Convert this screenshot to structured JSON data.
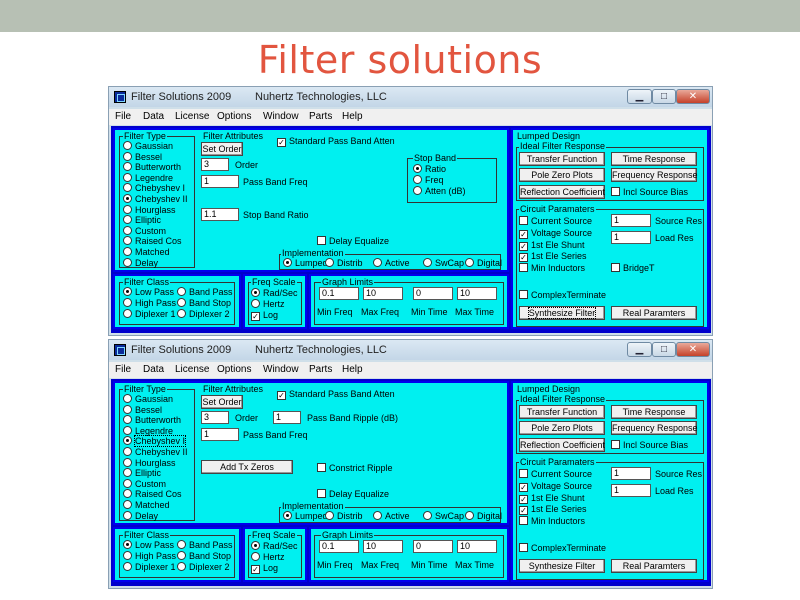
{
  "slide": {
    "title": "Filter solutions"
  },
  "windows": [
    {
      "app_title": "Filter Solutions 2009",
      "company": "Nuhertz Technologies, LLC",
      "controls": {
        "min": "▁",
        "max": "□",
        "close": "✕"
      },
      "menu": [
        "File",
        "Data",
        "License",
        "Options",
        "Window",
        "Parts",
        "Help"
      ],
      "filter_type": {
        "title": "Filter Type",
        "items": [
          "Gaussian",
          "Bessel",
          "Butterworth",
          "Legendre",
          "Chebyshev I",
          "Chebyshev II",
          "Hourglass",
          "Elliptic",
          "Custom",
          "Raised Cos",
          "Matched",
          "Delay"
        ],
        "selected": 5
      },
      "attr": {
        "title": "Filter Attributes",
        "set_order": "Set Order",
        "std_pass": "Standard Pass Band Atten",
        "order_val": "3",
        "order_label": "Order",
        "pbf_val": "1",
        "pbf_label": "Pass Band Freq",
        "sbr_val": "1.1",
        "sbr_label": "Stop Band Ratio",
        "delay_eq": "Delay Equalize"
      },
      "stop_band": {
        "title": "Stop Band",
        "items": [
          "Ratio",
          "Freq",
          "Atten (dB)"
        ],
        "selected": 0
      },
      "impl": {
        "title": "Implementation",
        "items": [
          "Lumped",
          "Distrib",
          "Active",
          "SwCap",
          "Digital"
        ],
        "selected": 0
      },
      "fclass": {
        "title": "Filter Class",
        "items": [
          "Low Pass",
          "Band Pass",
          "High Pass",
          "Band Stop",
          "Diplexer 1",
          "Diplexer 2"
        ],
        "selected": 0
      },
      "fscale": {
        "title": "Freq Scale",
        "rad": "Rad/Sec",
        "hertz": "Hertz",
        "log": "Log"
      },
      "glim": {
        "title": "Graph Limits",
        "vals": [
          "0.1",
          "10",
          "0",
          "10"
        ],
        "labels": [
          "Min Freq",
          "Max Freq",
          "Min Time",
          "Max Time"
        ]
      },
      "lumped": {
        "title": "Lumped Design",
        "ideal": "Ideal Filter Response",
        "transfer": "Transfer Function",
        "time": "Time Response",
        "pz": "Pole Zero Plots",
        "freq": "Frequency Response",
        "refl": "Reflection Coefficient",
        "incl": "Incl Source Bias"
      },
      "circuit": {
        "title": "Circuit Paramaters",
        "current": "Current Source",
        "voltage": "Voltage Source",
        "shunt": "1st Ele Shunt",
        "series": "1st Ele Series",
        "min_ind": "Min Inductors",
        "bridget": "BridgeT",
        "src_val": "1",
        "src_label": "Source Res",
        "load_val": "1",
        "load_label": "Load Res",
        "complex": "ComplexTerminate",
        "synth": "Synthesize Filter",
        "real": "Real Paramters"
      }
    },
    {
      "app_title": "Filter Solutions 2009",
      "company": "Nuhertz Technologies, LLC",
      "controls": {
        "min": "▁",
        "max": "□",
        "close": "✕"
      },
      "menu": [
        "File",
        "Data",
        "License",
        "Options",
        "Window",
        "Parts",
        "Help"
      ],
      "filter_type": {
        "title": "Filter Type",
        "items": [
          "Gaussian",
          "Bessel",
          "Butterworth",
          "Legendre",
          "Chebyshev I",
          "Chebyshev II",
          "Hourglass",
          "Elliptic",
          "Custom",
          "Raised Cos",
          "Matched",
          "Delay"
        ],
        "selected": 4
      },
      "attr": {
        "title": "Filter Attributes",
        "set_order": "Set Order",
        "std_pass": "Standard Pass Band Atten",
        "order_val": "3",
        "order_label": "Order",
        "ripple_val": "1",
        "ripple_label": "Pass Band Ripple (dB)",
        "pbf_val": "1",
        "pbf_label": "Pass Band Freq",
        "add_tx": "Add Tx Zeros",
        "constrict": "Constrict Ripple",
        "delay_eq": "Delay Equalize"
      },
      "impl": {
        "title": "Implementation",
        "items": [
          "Lumped",
          "Distrib",
          "Active",
          "SwCap",
          "Digital"
        ],
        "selected": 0
      },
      "fclass": {
        "title": "Filter Class",
        "items": [
          "Low Pass",
          "Band Pass",
          "High Pass",
          "Band Stop",
          "Diplexer 1",
          "Diplexer 2"
        ],
        "selected": 0
      },
      "fscale": {
        "title": "Freq Scale",
        "rad": "Rad/Sec",
        "hertz": "Hertz",
        "log": "Log"
      },
      "glim": {
        "title": "Graph Limits",
        "vals": [
          "0.1",
          "10",
          "0",
          "10"
        ],
        "labels": [
          "Min Freq",
          "Max Freq",
          "Min Time",
          "Max Time"
        ]
      },
      "lumped": {
        "title": "Lumped Design",
        "ideal": "Ideal Filter Response",
        "transfer": "Transfer Function",
        "time": "Time Response",
        "pz": "Pole Zero Plots",
        "freq": "Frequency Response",
        "refl": "Reflection Coefficient",
        "incl": "Incl Source Bias"
      },
      "circuit": {
        "title": "Circuit Paramaters",
        "current": "Current Source",
        "voltage": "Voltage Source",
        "shunt": "1st Ele Shunt",
        "series": "1st Ele Series",
        "min_ind": "Min Inductors",
        "src_val": "1",
        "src_label": "Source Res",
        "load_val": "1",
        "load_label": "Load Res",
        "complex": "ComplexTerminate",
        "synth": "Synthesize Filter",
        "real": "Real Paramters"
      }
    }
  ]
}
